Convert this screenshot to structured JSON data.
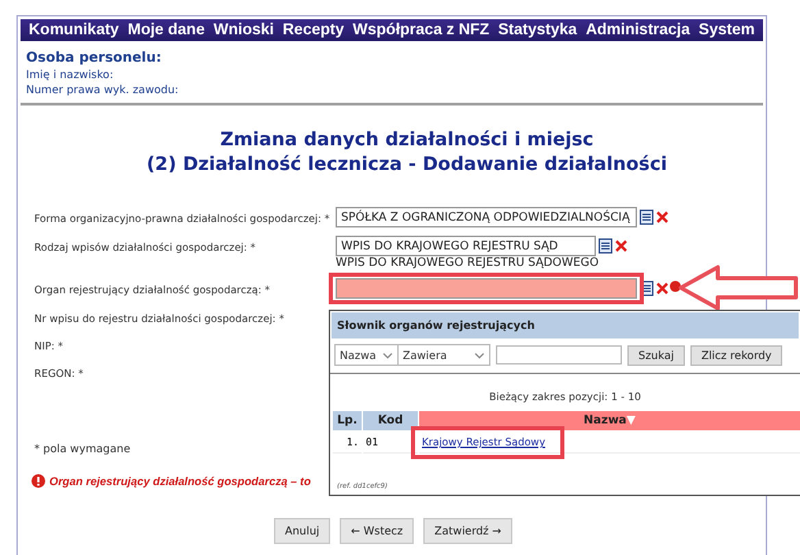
{
  "menu": [
    "Komunikaty",
    "Moje dane",
    "Wnioski",
    "Recepty",
    "Współpraca z NFZ",
    "Statystyka",
    "Administracja",
    "System"
  ],
  "staff": {
    "heading": "Osoba personelu:",
    "fields": [
      "Imię i nazwisko:",
      "Numer prawa wyk. zawodu:"
    ]
  },
  "title": [
    "Zmiana danych działalności i miejsc",
    "(2) Działalność lecznicza - Dodawanie działalności"
  ],
  "form": {
    "rows": [
      {
        "label": "Forma organizacyjno-prawna działalności gospodarczej: *",
        "kind": "picker",
        "value": "SPÓŁKA Z OGRANICZONĄ ODPOWIEDZIALNOŚCIĄ",
        "invalid": false
      },
      {
        "label": "Rodzaj wpisów działalności gospodarczej: *",
        "kind": "picker",
        "value": "WPIS DO KRAJOWEGO REJESTRU SĄD",
        "note": "WPIS DO KRAJOWEGO REJESTRU SĄDOWEGO",
        "invalid": false
      },
      {
        "label": "Organ rejestrujący działalność gospodarczą: *",
        "kind": "picker",
        "invalid": true,
        "highlighted": true
      },
      {
        "label": "Nr wpisu do rejestru działalności gospodarczej: *",
        "kind": "plain"
      },
      {
        "label": "NIP: *",
        "kind": "plain"
      },
      {
        "label": "REGON: *",
        "kind": "plain"
      }
    ]
  },
  "required_note": "* pola wymagane",
  "error": "Organ rejestrujący działalność gospodarczą – to",
  "buttons": [
    "Anuluj",
    "← Wstecz",
    "Zatwierdź →"
  ],
  "popup": {
    "title": "Słownik organów rejestrujących",
    "dropdowns": [
      "Nazwa",
      "Zawiera"
    ],
    "search_buttons": [
      "Szukaj",
      "Zlicz rekordy"
    ],
    "range": "Bieżący zakres pozycji: 1 - 10",
    "columns": [
      {
        "label": "Lp.",
        "sorted": false
      },
      {
        "label": "Kod",
        "sorted": false
      },
      {
        "label": "Nazwa",
        "sorted": true,
        "sort_mark": "▼"
      }
    ],
    "rows": [
      {
        "lp": "1.",
        "code": "01",
        "name": "Krajowy Rejestr Sądowy",
        "highlighted": true
      }
    ],
    "ref": "(ref. dd1cefc9)"
  }
}
